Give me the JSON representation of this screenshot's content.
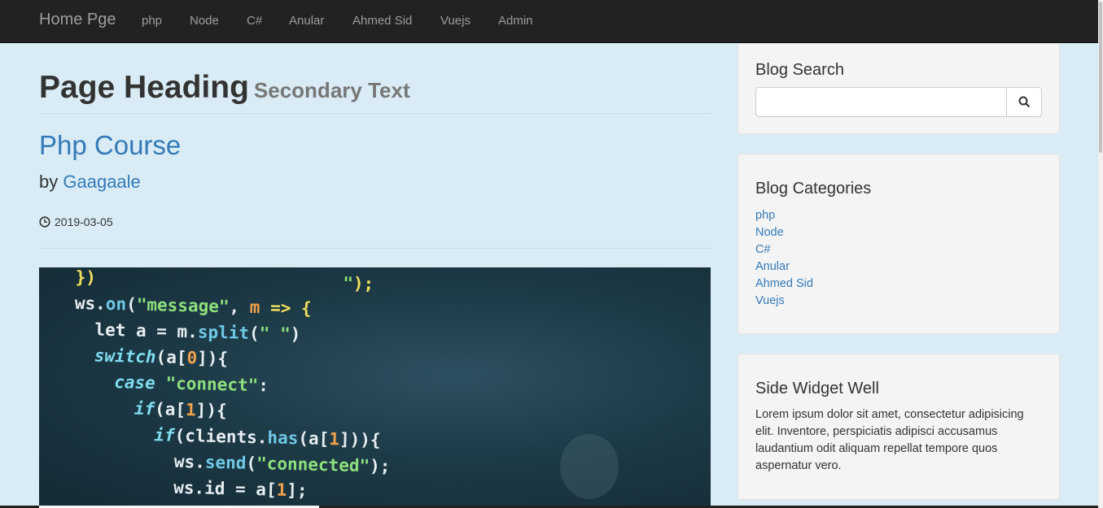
{
  "navbar": {
    "brand": "Home Pge",
    "items": [
      "php",
      "Node",
      "C#",
      "Anular",
      "Ahmed Sid",
      "Vuejs",
      "Admin"
    ]
  },
  "main": {
    "heading": "Page Heading",
    "heading_small": "Secondary Text",
    "post": {
      "title": "Php Course",
      "by": "by",
      "author": "Gaagaale",
      "date": "2019-03-05"
    }
  },
  "sidebar": {
    "search": {
      "title": "Blog Search",
      "value": "",
      "button_icon": "search-icon"
    },
    "categories": {
      "title": "Blog Categories",
      "items": [
        "php",
        "Node",
        "C#",
        "Anular",
        "Ahmed Sid",
        "Vuejs"
      ]
    },
    "widget": {
      "title": "Side Widget Well",
      "text": "Lorem ipsum dolor sit amet, consectetur adipisicing elit. Inventore, perspiciatis adipisci accusamus laudantium odit aliquam repellat tempore quos aspernatur vero."
    }
  },
  "colors": {
    "navbar": "#222222",
    "background": "#d9ecf5",
    "link": "#337ab7",
    "well": "#f4f4f4"
  }
}
